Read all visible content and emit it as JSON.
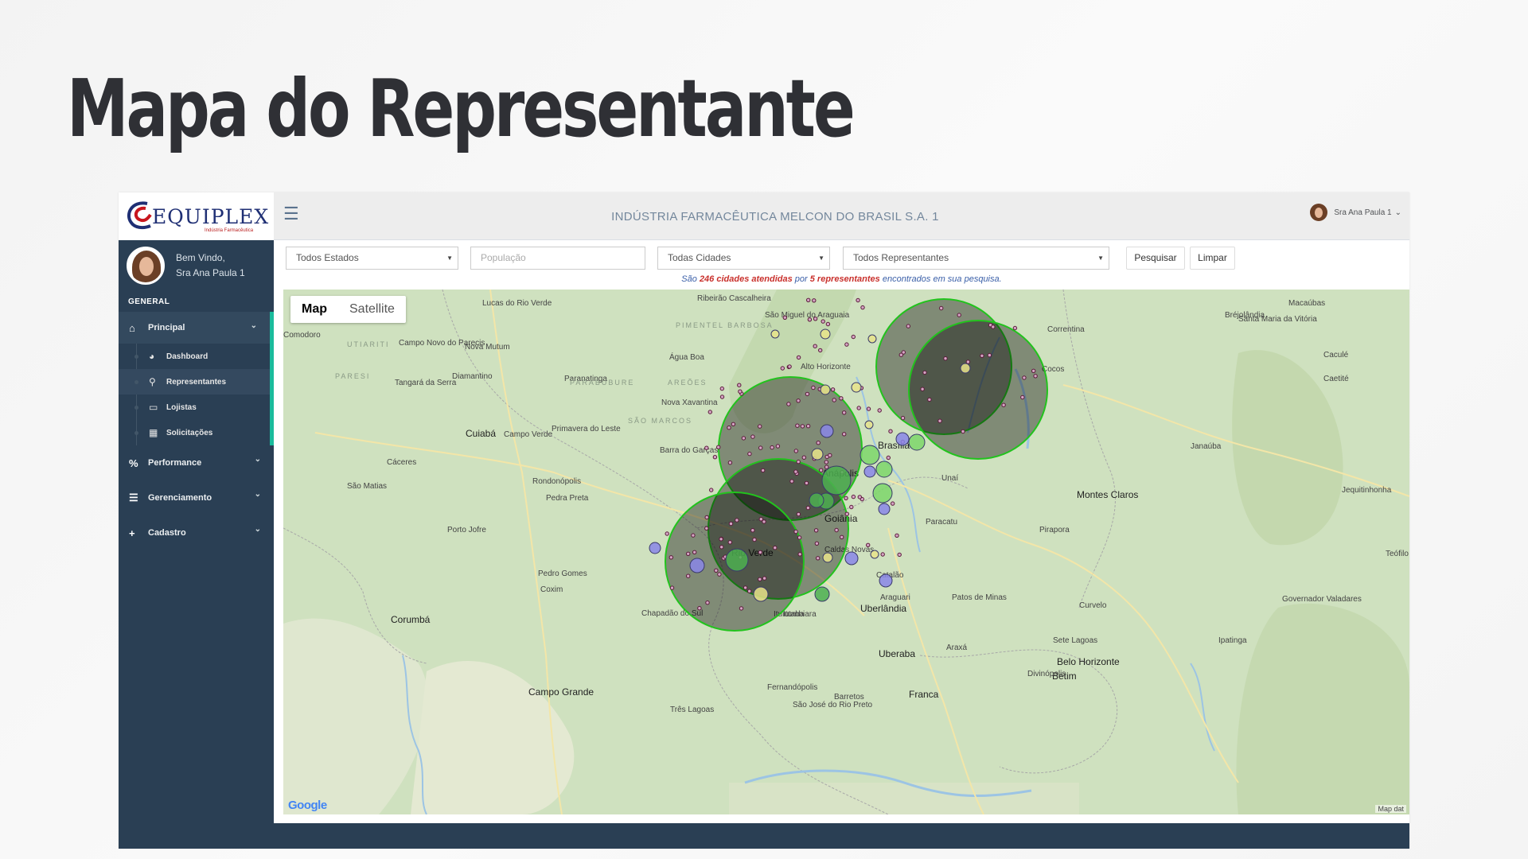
{
  "slide": {
    "title": "Mapa do Representante"
  },
  "brand": {
    "name": "EQUIPLEX",
    "tagline": "Indústria Farmacêutica",
    "colors": {
      "navy": "#1f2f74",
      "red": "#c8161d"
    }
  },
  "profile": {
    "greeting": "Bem Vindo,",
    "name": "Sra Ana Paula 1"
  },
  "sidebar": {
    "section_label": "GENERAL",
    "groups": [
      {
        "label": "Principal",
        "icon": "home-icon",
        "items": [
          {
            "label": "Dashboard",
            "icon": "pie-chart-icon"
          },
          {
            "label": "Representantes",
            "icon": "map-marker-icon"
          },
          {
            "label": "Lojistas",
            "icon": "map-icon"
          },
          {
            "label": "Solicitações",
            "icon": "map-icon"
          }
        ]
      },
      {
        "label": "Performance",
        "icon": "percent-icon"
      },
      {
        "label": "Gerenciamento",
        "icon": "list-icon"
      },
      {
        "label": "Cadastro",
        "icon": "plus-icon"
      }
    ],
    "colors": {
      "background": "#2a3f54",
      "accent": "#1abb9c"
    }
  },
  "topnav": {
    "company": "INDÚSTRIA FARMACÊUTICA MELCON DO BRASIL S.A. 1",
    "user": "Sra Ana Paula 1"
  },
  "filters": {
    "estado": "Todos Estados",
    "populacao_placeholder": "População",
    "cidade": "Todas Cidades",
    "representante": "Todos Representantes",
    "search_label": "Pesquisar",
    "clear_label": "Limpar"
  },
  "summary": {
    "prefix": "São",
    "cities": "246 cidades atendidas",
    "middle": "por",
    "reps": "5 representantes",
    "suffix": "encontrados em sua pesquisa."
  },
  "map": {
    "type_map": "Map",
    "type_satellite": "Satellite",
    "attribution": "Google",
    "map_data": "Map dat",
    "cities": [
      "Lucas do Rio Verde",
      "Ribeirão Cascalheira",
      "São Miguel do Araguaia",
      "Comodoro",
      "Campo Novo do Parecis",
      "Nova Mutum",
      "Água Boa",
      "Alto Horizonte",
      "Tangará da Serra",
      "Diamantino",
      "Paranatinga",
      "Nova Xavantina",
      "Cuiabá",
      "Campo Verde",
      "Primavera do Leste",
      "Barra do Garças",
      "Brasília",
      "Cáceres",
      "Rondonópolis",
      "São Matias",
      "Pedra Preta",
      "Anápolis",
      "Goiânia",
      "Unaí",
      "Montes Claros",
      "Paracatu",
      "Porto Jofre",
      "Pirapora",
      "Pedro Gomes",
      "Coxim",
      "Rio Verde",
      "Caldas Novas",
      "Catalão",
      "Patos de Minas",
      "Uberlândia",
      "Araguari",
      "Itumbiara",
      "Corumbá",
      "Uberaba",
      "Araxá",
      "Sete Lagoas",
      "Belo Horizonte",
      "Betim",
      "Divinópolis",
      "Campo Grande",
      "Franca",
      "Barretos",
      "São José do Rio Preto",
      "Três Lagoas",
      "Fernandópolis",
      "Ituiutaba",
      "Chapadão do Sul",
      "Janaúba",
      "Governador Valadares",
      "Ipatinga",
      "Curvelo",
      "Cocos",
      "Correntina",
      "Bréjolândia",
      "Santa Maria da Vitória",
      "Macaúbas",
      "Caculé",
      "Caetité",
      "Jequitinhonha",
      "Teófilo Otoni"
    ],
    "regions": [
      "PIMENTEL BARBOSA",
      "UTIARITI",
      "PARESI",
      "PARABUBURE",
      "AREÕES",
      "SÃO MARCOS"
    ],
    "colors": {
      "water": "#9cc4e4",
      "land": "#cfe1bf",
      "circle_fill": "#000000",
      "circle_stroke": "#22c31d"
    }
  }
}
